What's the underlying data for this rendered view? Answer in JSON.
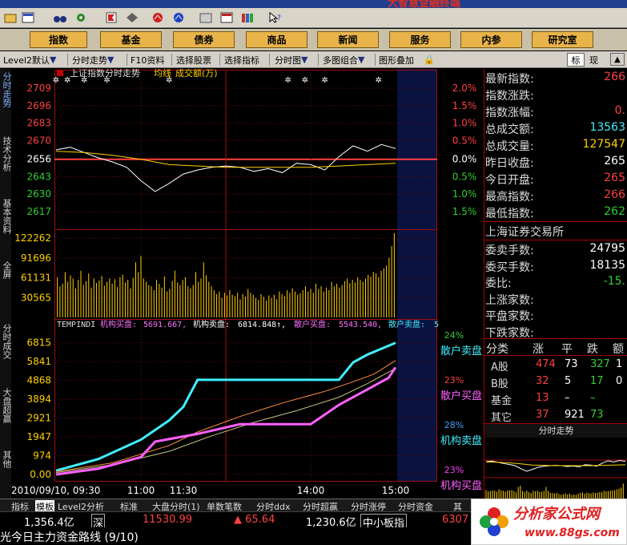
{
  "window": {
    "title_fragment": "大智慧金融终端"
  },
  "toolbar": {
    "icons": [
      "open-icon",
      "layout-icon",
      "binoculars-icon",
      "settings-icon",
      "flag-icon",
      "diamond-icon",
      "chart-red-icon",
      "chart-blue-icon",
      "window-icon",
      "news-window-icon",
      "books-icon",
      "help-pointer-icon"
    ]
  },
  "menu": {
    "items": [
      "指数",
      "基金",
      "债券",
      "商品",
      "新闻",
      "服务",
      "内参",
      "研究室"
    ]
  },
  "subbar": {
    "items": [
      "Level2默认",
      "分时走势",
      "F10资料",
      "选择股票",
      "选择指标",
      "分时图",
      "多图组合",
      "图形叠加"
    ],
    "tab_biao": "标",
    "tab_xian": "现"
  },
  "left_tabs": [
    "分时走势",
    "技术分析",
    "基本资料",
    "全屏",
    "分时成交",
    "大盘超赢",
    "其他"
  ],
  "chart_header": {
    "title": "上证指数分时走势",
    "avg_label": "均线",
    "vol_label": "成交额(万)"
  },
  "indicator_header": {
    "name": "TEMPINDI",
    "inst_buy_label": "机构买盘:",
    "inst_buy": "5691.667,",
    "inst_sell_label": "机构卖盘:",
    "inst_sell": "6814.848↑,",
    "retail_buy_label": "散户买盘:",
    "retail_buy": "5543.540,",
    "retail_sell_label": "散户卖盘:",
    "retail_sell": "5"
  },
  "chart_data": [
    {
      "type": "line",
      "title": "上证指数分时走势",
      "y_ticks_left": [
        "2709",
        "2696",
        "2683",
        "2670",
        "2656",
        "2643",
        "2630",
        "2617"
      ],
      "y_ticks_right": [
        "2.0%",
        "1.5%",
        "1.0%",
        "0.5%",
        "0.0%",
        "0.5%",
        "1.0%",
        "1.5%"
      ],
      "x_ticks": [
        "2010/09/10, 09:30",
        "11:00",
        "11:30",
        "14:00",
        "15:00"
      ],
      "ylim": [
        2611,
        2715
      ],
      "prev_close": 2656,
      "series": [
        {
          "name": "price",
          "x": [
            0,
            10,
            20,
            30,
            40,
            50,
            60,
            70,
            80,
            90,
            100,
            110,
            120,
            130,
            140,
            150,
            160,
            170,
            180,
            190,
            200,
            210,
            220,
            230,
            240
          ],
          "values": [
            2663,
            2665,
            2661,
            2657,
            2654,
            2650,
            2640,
            2632,
            2638,
            2645,
            2648,
            2650,
            2651,
            2650,
            2647,
            2649,
            2646,
            2653,
            2652,
            2648,
            2658,
            2666,
            2662,
            2667,
            2664
          ]
        },
        {
          "name": "均线",
          "x": [
            0,
            20,
            40,
            60,
            80,
            100,
            120,
            140,
            160,
            180,
            200,
            220,
            240
          ],
          "values": [
            2662,
            2661,
            2659,
            2656,
            2652,
            2651,
            2650,
            2650,
            2650,
            2650,
            2651,
            2652,
            2653
          ]
        }
      ]
    },
    {
      "type": "bar",
      "title": "成交额(万)",
      "y_ticks": [
        "122262",
        "91696",
        "61131",
        "30565"
      ],
      "ylim": [
        0,
        130000
      ],
      "values": [
        62000,
        48000,
        52000,
        70000,
        55000,
        65000,
        60000,
        45000,
        58000,
        72000,
        50000,
        56000,
        68000,
        46000,
        60000,
        53000,
        57000,
        64000,
        49000,
        55000,
        60000,
        52000,
        59000,
        47000,
        62000,
        66000,
        54000,
        58000,
        45000,
        61000,
        85000,
        70000,
        95000,
        60000,
        55000,
        50000,
        48000,
        42000,
        58000,
        52000,
        46000,
        63000,
        40000,
        44000,
        56000,
        72000,
        54000,
        50000,
        58000,
        62000,
        48000,
        45000,
        50000,
        70000,
        55000,
        60000,
        85000,
        65000,
        55000,
        48000,
        42000,
        36000,
        40000,
        30000,
        38000,
        34000,
        42000,
        35000,
        33000,
        38000,
        28000,
        36000,
        32000,
        44000,
        38000,
        35000,
        30000,
        27000,
        36000,
        32000,
        26000,
        34000,
        30000,
        35000,
        28000,
        40000,
        36000,
        33000,
        42000,
        38000,
        45000,
        40000,
        35000,
        37000,
        42000,
        48000,
        40000,
        44000,
        38000,
        52000,
        44000,
        48000,
        40000,
        46000,
        42000,
        55000,
        48000,
        52000,
        46000,
        50000,
        56000,
        60000,
        53000,
        58000,
        54000,
        62000,
        58000,
        55000,
        60000,
        66000,
        63000,
        70000,
        68000,
        62000,
        72000,
        76000,
        80000,
        92000,
        110000,
        130000
      ]
    },
    {
      "type": "line",
      "title": "TEMPINDI",
      "y_ticks": [
        "6815",
        "5841",
        "4868",
        "3894",
        "2921",
        "1947",
        "974",
        "0.00"
      ],
      "ylim": [
        0,
        7300
      ],
      "series": [
        {
          "name": "散户卖盘",
          "x": [
            0,
            30,
            60,
            80,
            90,
            100,
            110,
            140,
            170,
            200,
            210,
            220,
            240
          ],
          "values": [
            200,
            800,
            1800,
            2800,
            3500,
            4900,
            4900,
            4900,
            4900,
            4900,
            5800,
            6200,
            6815
          ]
        },
        {
          "name": "机构卖盘",
          "x": [
            0,
            40,
            80,
            100,
            130,
            160,
            190,
            210,
            225,
            240
          ],
          "values": [
            150,
            600,
            1500,
            2200,
            3000,
            3700,
            4300,
            4800,
            5200,
            5900
          ]
        },
        {
          "name": "机构买盘",
          "x": [
            0,
            40,
            80,
            110,
            140,
            170,
            200,
            220,
            240
          ],
          "values": [
            100,
            500,
            1200,
            2000,
            2700,
            3300,
            4000,
            4700,
            5500
          ]
        },
        {
          "name": "散户买盘",
          "x": [
            0,
            30,
            60,
            70,
            100,
            130,
            150,
            170,
            180,
            200,
            210,
            220,
            235,
            240
          ],
          "values": [
            0,
            300,
            900,
            1700,
            2100,
            2600,
            2600,
            2600,
            2600,
            3600,
            4000,
            4400,
            5000,
            5544
          ]
        }
      ],
      "right_labels": [
        {
          "pct": "24%",
          "name": "散户卖盘"
        },
        {
          "pct": "23%",
          "name": "散户买盘"
        },
        {
          "pct": "28%",
          "name": "机构卖盘"
        },
        {
          "pct": "23%",
          "name": "机构买盘"
        }
      ]
    }
  ],
  "right_panel": {
    "quote": [
      {
        "label": "最新指数:",
        "value": "266"
      },
      {
        "label": "指数涨跌:",
        "value": ""
      },
      {
        "label": "指数涨幅:",
        "value": "0."
      },
      {
        "label": "总成交额:",
        "value": "13563"
      },
      {
        "label": "总成交量:",
        "value": "127547"
      },
      {
        "label": "昨日收盘:",
        "value": "265"
      },
      {
        "label": "今日开盘:",
        "value": "265"
      },
      {
        "label": "最高指数:",
        "value": "266"
      },
      {
        "label": "最低指数:",
        "value": "262"
      }
    ],
    "exchange": "上海证券交易所",
    "stats": [
      {
        "label": "委卖手数:",
        "value": "24795"
      },
      {
        "label": "委买手数:",
        "value": "18135"
      },
      {
        "label": "委比:",
        "value": "-15."
      },
      {
        "label": "上涨家数:",
        "value": ""
      },
      {
        "label": "平盘家数:",
        "value": ""
      },
      {
        "label": "下跌家数:",
        "value": ""
      }
    ],
    "table_headers": [
      "分类",
      "涨",
      "平",
      "跌",
      "额"
    ],
    "table_rows": [
      {
        "cat": "A股",
        "up": "474",
        "flat": "73",
        "down": "327",
        "amt": "1"
      },
      {
        "cat": "B股",
        "up": "32",
        "flat": "5",
        "down": "17",
        "amt": "0"
      },
      {
        "cat": "基金",
        "up": "13",
        "flat": "–",
        "down": "–",
        "amt": ""
      },
      {
        "cat": "其它",
        "up": "37",
        "flat": "921",
        "down": "73",
        "amt": ""
      }
    ],
    "mini_chart_title": "分时走势"
  },
  "bottom_tabs": [
    "指标",
    "模板",
    "Level2分析",
    "标准",
    "大盘分时(1)",
    "单数笔数",
    "分时ddx",
    "分时超赢",
    "分时涨停",
    "分时资金",
    "其"
  ],
  "status": {
    "sh_amount": "1,356.4亿",
    "sh_label": "深",
    "sz_index": "11530.99",
    "sz_change": "▲ 65.64",
    "sz_amount": "1,230.6亿",
    "sme_label": "中小板指",
    "sme_value": "6307"
  },
  "ticker": {
    "text": "光今日主力资金路线 (9/10)"
  },
  "watermark": {
    "title": "分析家公式网",
    "url": "www.88gs.com"
  }
}
